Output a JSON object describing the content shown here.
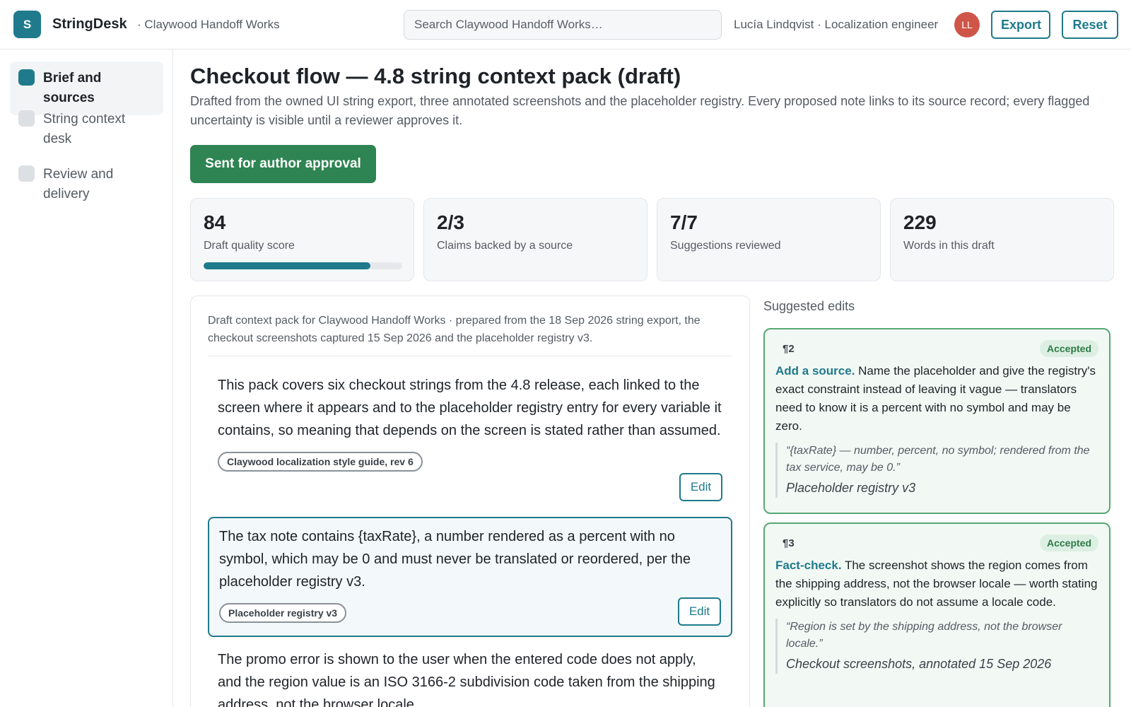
{
  "app": {
    "logo_letter": "S",
    "name": "StringDesk",
    "workspace": "· Claywood Handoff Works"
  },
  "search": {
    "placeholder": "Search Claywood Handoff Works…"
  },
  "user": {
    "label": "Lucía Lindqvist · Localization engineer",
    "initials": "LL"
  },
  "header_actions": {
    "export": "Export",
    "reset": "Reset"
  },
  "sidebar": {
    "items": [
      {
        "label": "Brief and sources",
        "active": true
      },
      {
        "label": "String context desk",
        "active": false
      },
      {
        "label": "Review and delivery",
        "active": false
      }
    ]
  },
  "page": {
    "title": "Checkout flow — 4.8 string context pack (draft)",
    "description": "Drafted from the owned UI string export, three annotated screenshots and the placeholder registry. Every proposed note links to its source record; every flagged uncertainty is visible until a reviewer approves it.",
    "primary_action": "Sent for author approval"
  },
  "stats": [
    {
      "value": "84",
      "label": "Draft quality score",
      "progress": 0.84
    },
    {
      "value": "2/3",
      "label": "Claims backed by a source"
    },
    {
      "value": "7/7",
      "label": "Suggestions reviewed"
    },
    {
      "value": "229",
      "label": "Words in this draft"
    }
  ],
  "draft": {
    "header": "Draft context pack for Claywood Handoff Works · prepared from the 18 Sep 2026 string export, the checkout screenshots captured 15 Sep 2026 and the placeholder registry v3.",
    "edit_label": "Edit",
    "paragraphs": [
      {
        "text": "This pack covers six checkout strings from the 4.8 release, each linked to the screen where it appears and to the placeholder registry entry for every variable it contains, so meaning that depends on the screen is stated rather than assumed.",
        "source": "Claywood localization style guide, rev 6"
      },
      {
        "text": "The tax note contains {taxRate}, a number rendered as a percent with no symbol, which may be 0 and must never be translated or reordered, per the placeholder registry v3.",
        "source": "Placeholder registry v3"
      },
      {
        "text": "The promo error is shown to the user when the entered code does not apply, and the region value is an ISO 3166-2 subdivision code taken from the shipping address, not the browser locale."
      }
    ]
  },
  "suggestions": {
    "heading": "Suggested edits",
    "items": [
      {
        "para": "¶2",
        "status": "Accepted",
        "kind": "Add a source.",
        "body": "Name the placeholder and give the registry's exact constraint instead of leaving it vague — translators need to know it is a percent with no symbol and may be zero.",
        "quote": "“{taxRate} — number, percent, no symbol; rendered from the tax service, may be 0.”",
        "source": "Placeholder registry v3"
      },
      {
        "para": "¶3",
        "status": "Accepted",
        "kind": "Fact-check.",
        "body": "The screenshot shows the region comes from the shipping address, not the browser locale — worth stating explicitly so translators do not assume a locale code.",
        "quote": "“Region is set by the shipping address, not the browser locale.”",
        "source": "Checkout screenshots, annotated 15 Sep 2026"
      }
    ]
  },
  "colors": {
    "accent": "#1f7a8c",
    "primary_button": "#2e8452",
    "accepted_border": "#58a872",
    "avatar": "#cf5548"
  }
}
